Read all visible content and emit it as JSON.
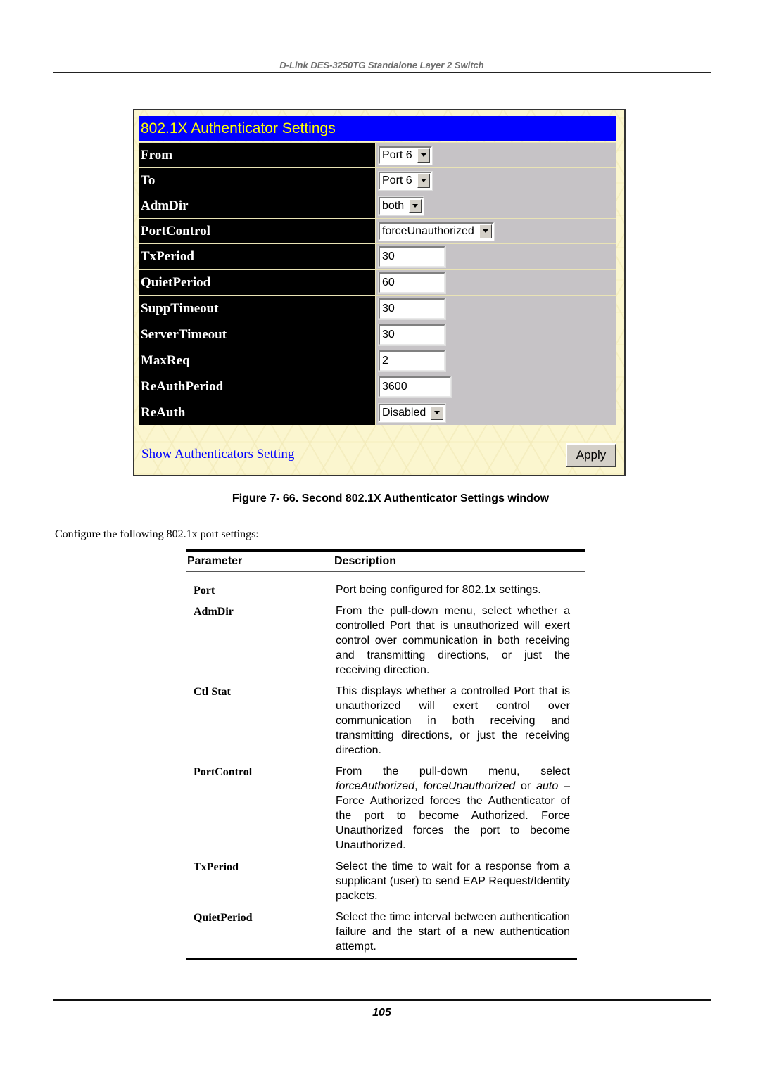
{
  "document": {
    "running_header": "D-Link DES-3250TG Standalone Layer 2 Switch",
    "page_number": "105"
  },
  "panel": {
    "title": "802.1X Authenticator Settings",
    "fields": {
      "from": {
        "label": "From",
        "value": "Port 6"
      },
      "to": {
        "label": "To",
        "value": "Port 6"
      },
      "admdir": {
        "label": "AdmDir",
        "value": "both"
      },
      "portcontrol": {
        "label": "PortControl",
        "value": "forceUnauthorized"
      },
      "txperiod": {
        "label": "TxPeriod",
        "value": "30"
      },
      "quietperiod": {
        "label": "QuietPeriod",
        "value": "60"
      },
      "supptimeout": {
        "label": "SuppTimeout",
        "value": "30"
      },
      "servertimeout": {
        "label": "ServerTimeout",
        "value": "30"
      },
      "maxreq": {
        "label": "MaxReq",
        "value": "2"
      },
      "reauthperiod": {
        "label": "ReAuthPeriod",
        "value": "3600"
      },
      "reauth": {
        "label": "ReAuth",
        "value": "Disabled"
      }
    },
    "show_link": "Show Authenticators Setting",
    "apply_label": "Apply",
    "colors": {
      "title_bg": "#0000ff",
      "title_text": "#ffff00",
      "label_bg": "#000000",
      "field_bg": "#c6c3c6",
      "panel_bg": "#fbf6cf"
    }
  },
  "figure_caption": "Figure 7- 66. Second 802.1X Authenticator Settings window",
  "intro_text": "Configure the following 802.1x port settings:",
  "param_table": {
    "headers": {
      "parameter": "Parameter",
      "description": "Description"
    },
    "rows": [
      {
        "parameter": "Port",
        "description": "Port being configured for 802.1x settings."
      },
      {
        "parameter": "AdmDir",
        "description": "From the pull-down menu, select whether a controlled Port that is unauthorized will exert control over communication in both receiving and transmitting directions, or just the receiving direction."
      },
      {
        "parameter": "Ctl Stat",
        "description": "This displays whether a controlled Port that is unauthorized will exert control over communication in both receiving and transmitting directions, or just the receiving direction."
      },
      {
        "parameter": "PortControl",
        "desc_parts": {
          "pre": "From the pull-down menu, select ",
          "opt1": "forceAuthorized",
          "sep1": ", ",
          "opt2": "forceUnauthorized",
          "sep2": " or ",
          "opt3": "auto",
          "post": " – Force Authorized forces the Authenticator of the port to become Authorized. Force Unauthorized forces the port to become Unauthorized."
        }
      },
      {
        "parameter": "TxPeriod",
        "description": "Select the time to wait for a response from a supplicant (user) to send EAP Request/Identity packets."
      },
      {
        "parameter": "QuietPeriod",
        "description": "Select the time interval between authentication failure and the start of a new authentication attempt."
      }
    ]
  }
}
